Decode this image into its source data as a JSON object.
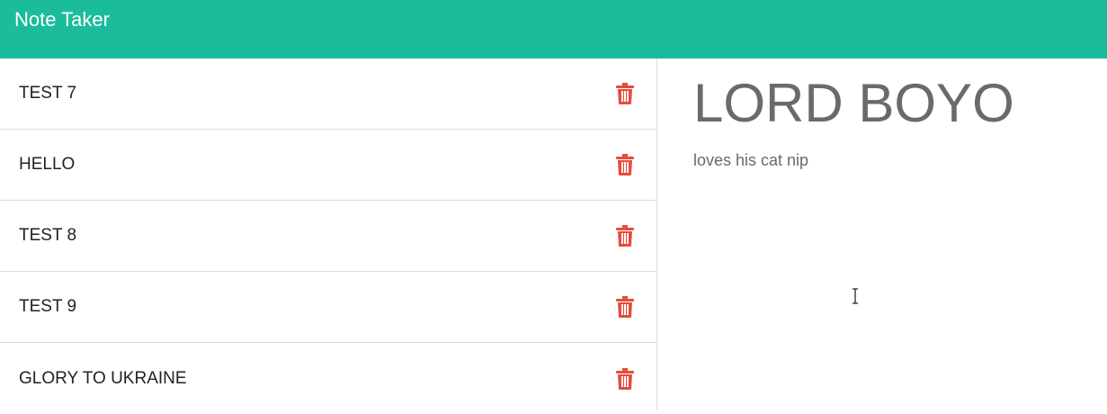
{
  "app": {
    "title": "Note Taker",
    "accent_color": "#1abc9c"
  },
  "notes": [
    {
      "title": "TEST 7"
    },
    {
      "title": "HELLO"
    },
    {
      "title": "TEST 8"
    },
    {
      "title": "TEST 9"
    },
    {
      "title": "GLORY TO UKRAINE"
    }
  ],
  "delete_icon": {
    "name": "trash-icon",
    "color": "#e74c3c"
  },
  "active_note": {
    "title": "LORD BOYO",
    "text": "loves his cat nip"
  }
}
